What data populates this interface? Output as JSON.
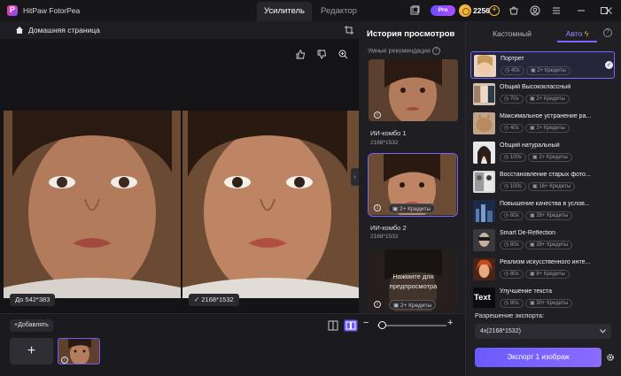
{
  "app": {
    "title": "HitPaw FotorPea",
    "tab_enhancer": "Усилитель",
    "tab_editor": "Редактор",
    "pro_label": "Pro",
    "credits": "2256"
  },
  "canvas": {
    "home_label": "Домашняя страница",
    "before_size": "До 542*383",
    "after_size": "2168*1532"
  },
  "bottom": {
    "add_label": "Добавлять",
    "add_plus": "+",
    "zoom_minus": "−",
    "zoom_plus": "+",
    "zoom_level": 0.02
  },
  "history": {
    "title": "История просмотров",
    "smart_label": "Умные рекомендации",
    "cards": [
      {
        "name": "ИИ-комбо 1",
        "size": "2168*1532"
      },
      {
        "name": "ИИ-комбо 2",
        "size": "2168*1532",
        "credit": "2+ Кредиты"
      },
      {
        "preview_line1": "Нажмите для",
        "preview_line2": "предпросмотра",
        "credit": "2+ Кредиты"
      }
    ]
  },
  "right": {
    "tab_custom": "Кастомный",
    "tab_auto": "Авто",
    "modes": [
      {
        "name": "Портрет",
        "time": "40s",
        "credits": "2+ Кредиты"
      },
      {
        "name": "Общий Высококлассный",
        "time": "70s",
        "credits": "2+ Кредиты"
      },
      {
        "name": "Максимальное устранение ра...",
        "time": "40s",
        "credits": "2+ Кредиты"
      },
      {
        "name": "Общий натуральный",
        "time": "100s",
        "credits": "2+ Кредиты"
      },
      {
        "name": "Восстановление старых фото...",
        "time": "100s",
        "credits": "16+ Кредиты"
      },
      {
        "name": "Повышение качества в услов...",
        "time": "80s",
        "credits": "28+ Кредиты"
      },
      {
        "name": "Smart De-Reflection",
        "time": "80s",
        "credits": "28+ Кредиты"
      },
      {
        "name": "Реализм искусственного инте...",
        "time": "80s",
        "credits": "8+ Кредиты"
      },
      {
        "name": "Улучшение текста",
        "time": "80s",
        "credits": "30+ Кредиты"
      }
    ],
    "text_thumb": "Text",
    "export_label": "Разрешение экспорта:",
    "export_value": "4x(2168*1532)",
    "export_button": "Экспорт 1 изображ"
  },
  "colors": {
    "accent": "#7a66ff",
    "coin": "#f2b544"
  }
}
